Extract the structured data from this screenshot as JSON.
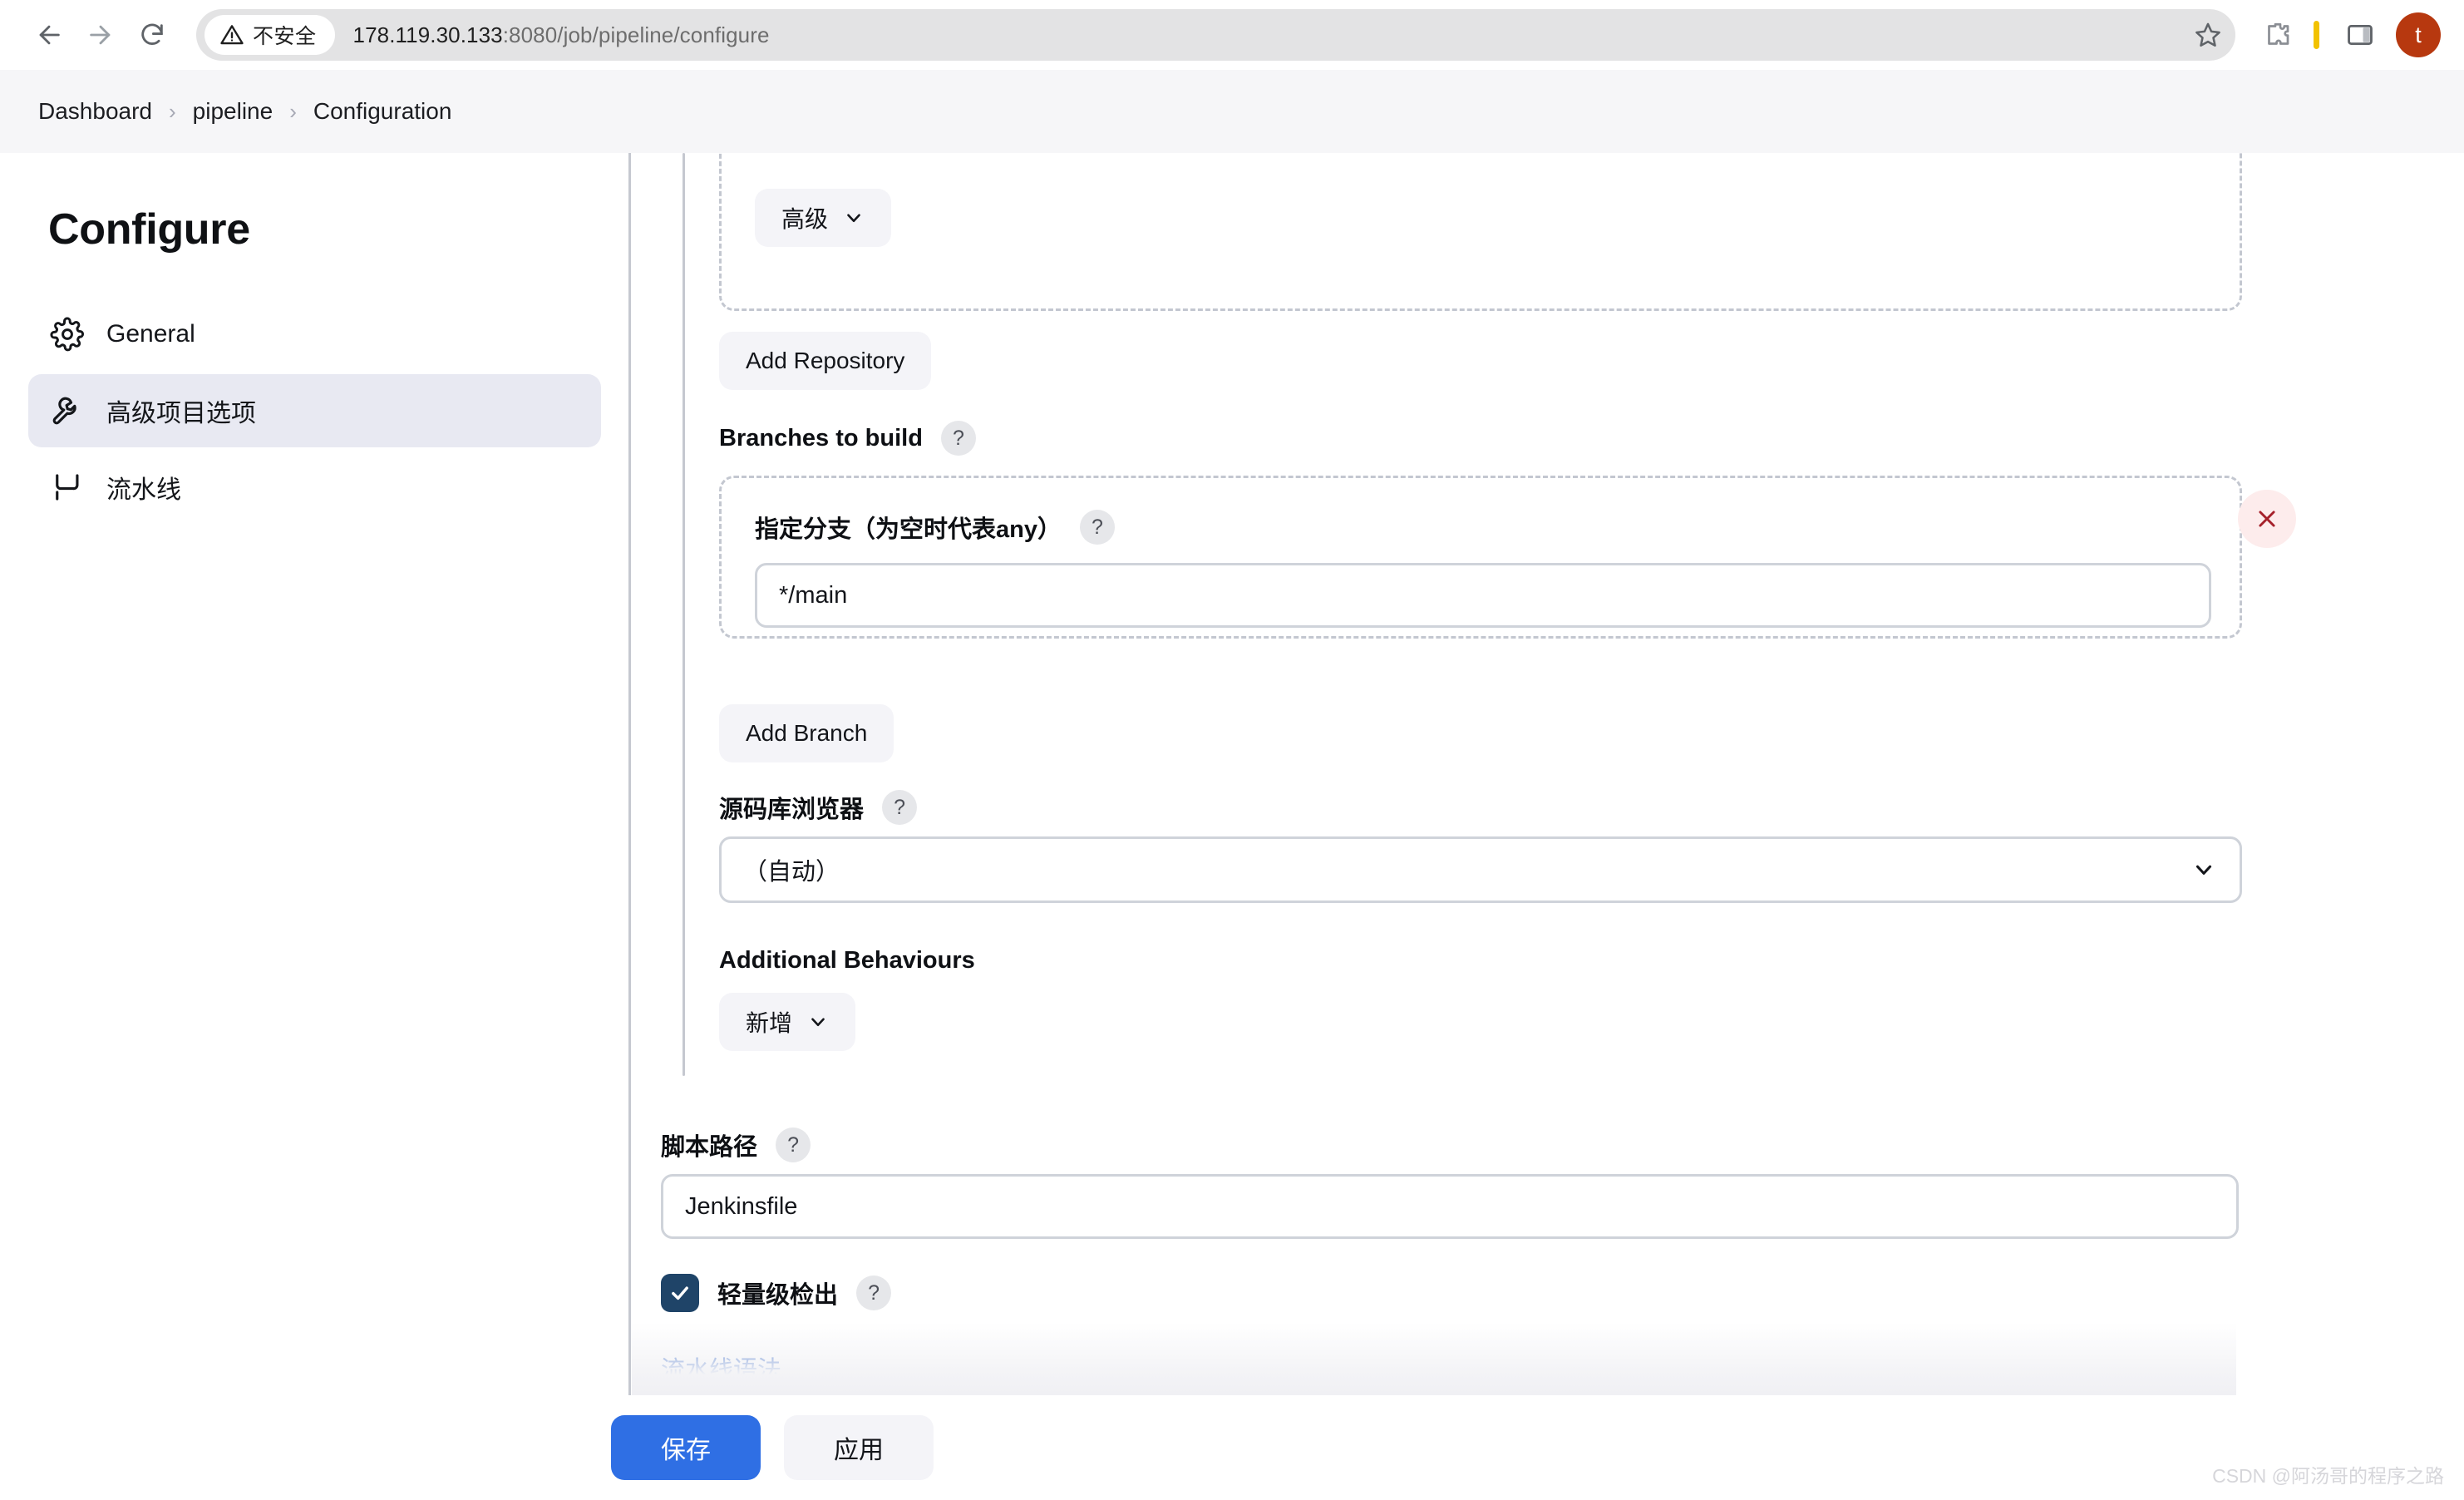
{
  "browser": {
    "back_icon": "arrow-left-icon",
    "forward_icon": "arrow-right-icon",
    "reload_icon": "reload-icon",
    "security_warning_label": "不安全",
    "security_warning_icon": "warning-triangle-icon",
    "url_host": "178.119.30.133",
    "url_path": ":8080/job/pipeline/configure",
    "url_full": "178.119.30.133:8080/job/pipeline/configure",
    "bookmark_icon": "star-icon",
    "extensions_icon": "puzzle-piece-icon",
    "split_view_icon": "side-panel-icon",
    "profile_initial": "t",
    "profile_color": "#b7380f"
  },
  "breadcrumb": {
    "items": [
      {
        "label": "Dashboard"
      },
      {
        "label": "pipeline"
      },
      {
        "label": "Configuration"
      }
    ],
    "separator": "›"
  },
  "sidebar": {
    "title": "Configure",
    "items": [
      {
        "label": "General",
        "icon": "gear-icon",
        "active": false
      },
      {
        "label": "高级项目选项",
        "icon": "wrench-icon",
        "active": true
      },
      {
        "label": "流水线",
        "icon": "pipeline-icon",
        "active": false
      }
    ]
  },
  "form": {
    "advanced_button": {
      "label": "高级",
      "icon": "chevron-down-icon"
    },
    "add_repository_button": {
      "label": "Add Repository"
    },
    "branches_to_build": {
      "label": "Branches to build",
      "help": "?"
    },
    "branch_spec": {
      "label": "指定分支（为空时代表any）",
      "help": "?",
      "value": "*/main",
      "delete_icon": "close-x-icon"
    },
    "add_branch_button": {
      "label": "Add Branch"
    },
    "repository_browser": {
      "label": "源码库浏览器",
      "help": "?",
      "selected": "（自动）",
      "chevron": "chevron-down-icon"
    },
    "additional_behaviours": {
      "label": "Additional Behaviours",
      "add_button": {
        "label": "新增",
        "icon": "chevron-down-icon"
      }
    },
    "script_path": {
      "label": "脚本路径",
      "help": "?",
      "value": "Jenkinsfile"
    },
    "lightweight_checkout": {
      "label": "轻量级检出",
      "help": "?",
      "checked": true
    },
    "pipeline_syntax_link": {
      "label": "流水线语法"
    }
  },
  "footer": {
    "save_button": "保存",
    "apply_button": "应用",
    "save_color": "#2f6fe4"
  },
  "watermark": "CSDN @阿汤哥的程序之路"
}
